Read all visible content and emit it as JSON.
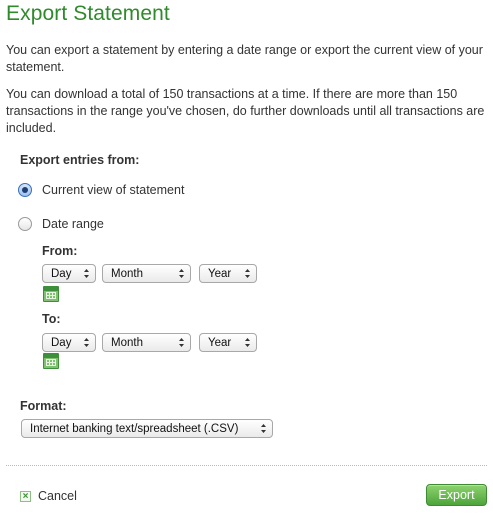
{
  "title": "Export Statement",
  "intro": {
    "paragraph1": "You can export a statement by entering a date range or export the current view of your statement.",
    "paragraph2": "You can download a total of 150 transactions at a time. If there are more than 150 transactions in the range you've chosen, do further downloads until all transactions are included."
  },
  "export_from": {
    "label": "Export entries from:",
    "options": [
      {
        "label": "Current view of statement",
        "checked": true
      },
      {
        "label": "Date range",
        "checked": false
      }
    ]
  },
  "from": {
    "label": "From:",
    "day": "Day",
    "month": "Month",
    "year": "Year",
    "calendar_icon": "calendar-icon"
  },
  "to": {
    "label": "To:",
    "day": "Day",
    "month": "Month",
    "year": "Year",
    "calendar_icon": "calendar-icon"
  },
  "format": {
    "label": "Format:",
    "selected": "Internet banking text/spreadsheet (.CSV)"
  },
  "footer": {
    "cancel_label": "Cancel",
    "export_label": "Export"
  },
  "colors": {
    "title": "#2f8a2c",
    "export_button": "#5fb347"
  }
}
